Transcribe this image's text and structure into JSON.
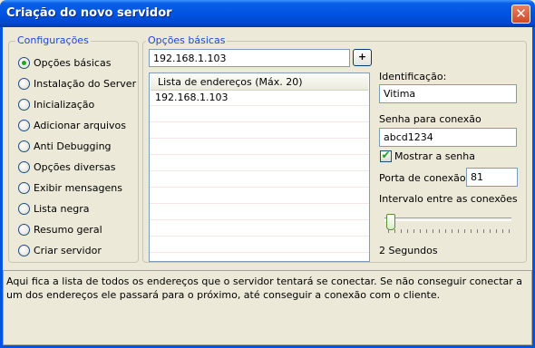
{
  "window": {
    "title": "Criação do novo servidor",
    "close_glyph": "✕"
  },
  "config": {
    "legend": "Configurações",
    "items": [
      {
        "label": "Opções básicas",
        "checked": true
      },
      {
        "label": "Instalação do Server",
        "checked": false
      },
      {
        "label": "Inicialização",
        "checked": false
      },
      {
        "label": "Adicionar arquivos",
        "checked": false
      },
      {
        "label": "Anti Debugging",
        "checked": false
      },
      {
        "label": "Opções diversas",
        "checked": false
      },
      {
        "label": "Exibir mensagens",
        "checked": false
      },
      {
        "label": "Lista negra",
        "checked": false
      },
      {
        "label": "Resumo geral",
        "checked": false
      },
      {
        "label": "Criar servidor",
        "checked": false
      }
    ]
  },
  "basic": {
    "legend": "Opções básicas",
    "address_value": "192.168.1.103",
    "add_label": "+",
    "list_header": "Lista de endereços (Máx. 20)",
    "list_rows": [
      "192.168.1.103"
    ],
    "id_label": "Identificação:",
    "id_value": "Vitima",
    "pass_label": "Senha para conexão",
    "pass_value": "abcd1234",
    "show_pass_label": "Mostrar a senha",
    "show_pass_checked": true,
    "port_label": "Porta de conexão",
    "port_value": "81",
    "interval_label": "Intervalo entre as conexões",
    "interval_value": "2 Segundos",
    "interval_fraction": 0.0
  },
  "description": "Aqui fica a lista de todos os endereços que o servidor tentará se conectar. Se não conseguir conectar a um dos endereços ele passará para o próximo, até conseguir a conexão com o cliente.",
  "colors": {
    "title_bar": "#0054e3",
    "legend_text": "#1c49d4",
    "background": "#ece9d8"
  }
}
